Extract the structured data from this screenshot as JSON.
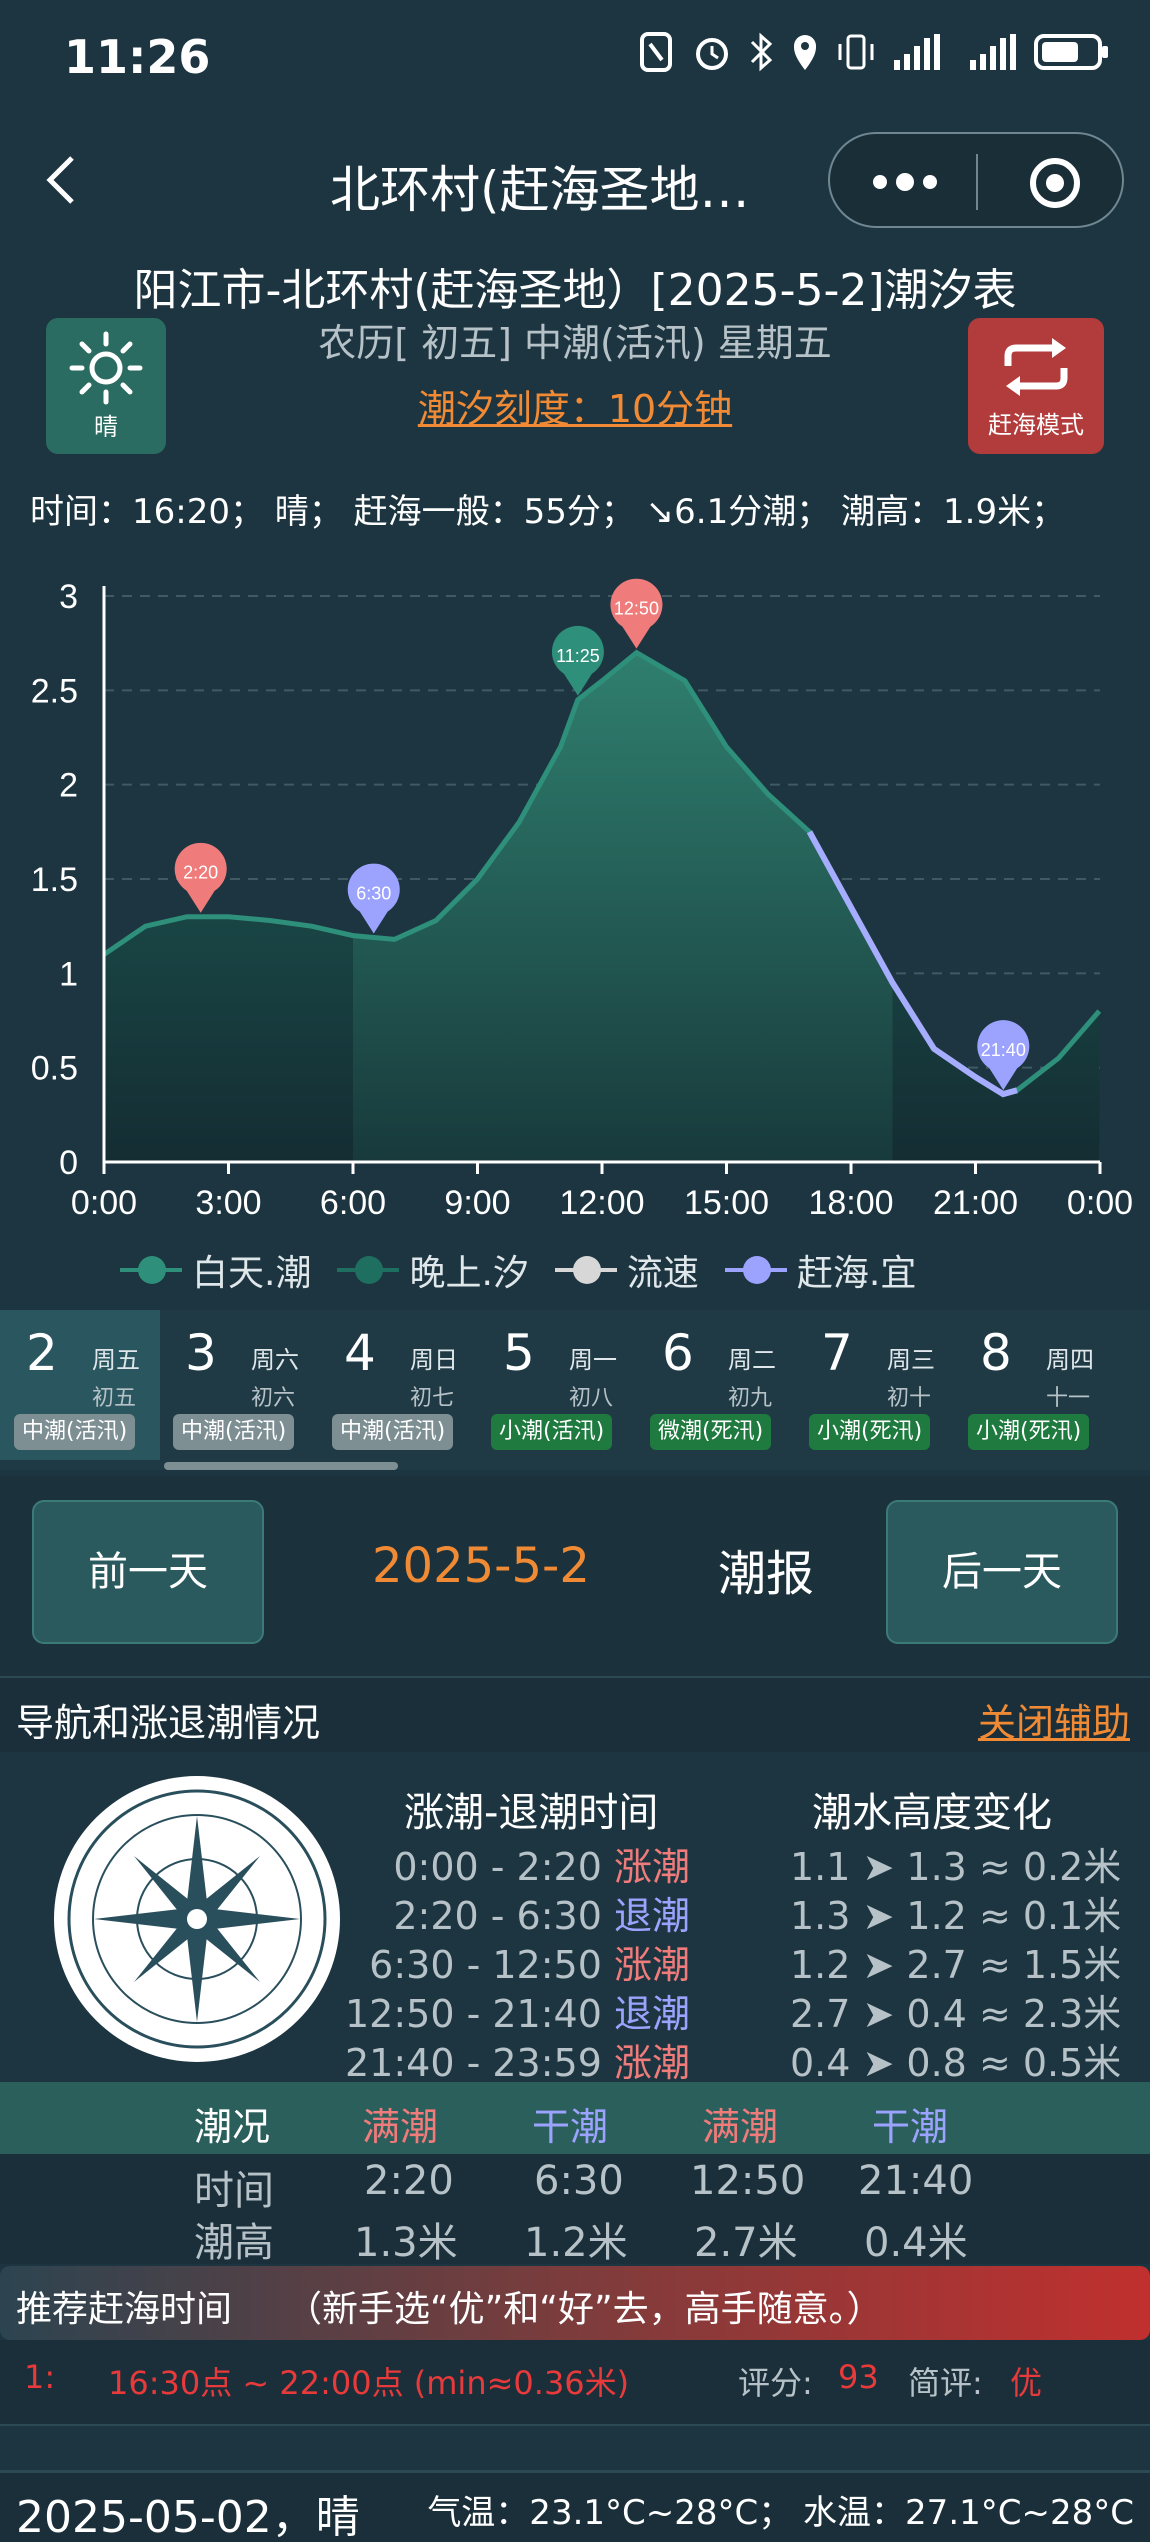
{
  "status": {
    "time": "11:26"
  },
  "header": {
    "title": "北环村(赶海圣地…"
  },
  "info": {
    "heading": "阳江市-北环村(赶海圣地）[2025-5-2]潮汐表",
    "lunar": "农历[ 初五] 中潮(活汛) 星期五",
    "scale": "潮汐刻度：10分钟",
    "weather_label": "晴",
    "mode_label": "赶海模式",
    "line": "时间：16:20； 晴； 赶海一般：55分； ↘6.1分潮； 潮高：1.9米；"
  },
  "chart_data": {
    "type": "area",
    "x": [
      "0:00",
      "1:00",
      "2:00",
      "2:20",
      "3:00",
      "4:00",
      "5:00",
      "6:00",
      "6:30",
      "7:00",
      "8:00",
      "9:00",
      "10:00",
      "11:00",
      "11:25",
      "12:00",
      "12:50",
      "14:00",
      "15:00",
      "16:00",
      "17:00",
      "18:00",
      "19:00",
      "20:00",
      "21:00",
      "21:40",
      "22:00",
      "23:00",
      "23:59"
    ],
    "values": [
      1.1,
      1.25,
      1.3,
      1.3,
      1.3,
      1.28,
      1.25,
      1.2,
      1.19,
      1.18,
      1.28,
      1.5,
      1.8,
      2.2,
      2.45,
      2.55,
      2.7,
      2.55,
      2.2,
      1.95,
      1.75,
      1.35,
      0.95,
      0.6,
      0.45,
      0.36,
      0.38,
      0.55,
      0.8
    ],
    "xticks": [
      "0:00",
      "3:00",
      "6:00",
      "9:00",
      "12:00",
      "15:00",
      "18:00",
      "21:00",
      "0:00"
    ],
    "yticks": [
      "0",
      "0.5",
      "1",
      "1.5",
      "2",
      "2.5",
      "3"
    ],
    "ylim": [
      0,
      3
    ],
    "series_names": [
      "白天.潮",
      "晚上.汐",
      "流速",
      "赶海.宜"
    ],
    "markers": [
      {
        "label": "2:20",
        "x": 2.33,
        "y": 1.3,
        "color": "#ef7b7b"
      },
      {
        "label": "6:30",
        "x": 6.5,
        "y": 1.19,
        "color": "#9ca3ff"
      },
      {
        "label": "11:25",
        "x": 11.42,
        "y": 2.45,
        "color": "#2e8f7a"
      },
      {
        "label": "12:50",
        "x": 12.83,
        "y": 2.7,
        "color": "#ef7b7b"
      },
      {
        "label": "21:40",
        "x": 21.67,
        "y": 0.36,
        "color": "#9ca3ff"
      }
    ],
    "highlight_range": [
      "16:30",
      "22:00"
    ]
  },
  "legend": {
    "day": "白天.潮",
    "night": "晚上.汐",
    "speed": "流速",
    "good": "赶海.宜"
  },
  "days": [
    {
      "num": "2",
      "weekday": "周五",
      "lunar": "初五",
      "tag": "中潮(活汛)",
      "tone": "grey"
    },
    {
      "num": "3",
      "weekday": "周六",
      "lunar": "初六",
      "tag": "中潮(活汛)",
      "tone": "grey"
    },
    {
      "num": "4",
      "weekday": "周日",
      "lunar": "初七",
      "tag": "中潮(活汛)",
      "tone": "grey"
    },
    {
      "num": "5",
      "weekday": "周一",
      "lunar": "初八",
      "tag": "小潮(活汛)",
      "tone": "green"
    },
    {
      "num": "6",
      "weekday": "周二",
      "lunar": "初九",
      "tag": "微潮(死汛)",
      "tone": "green"
    },
    {
      "num": "7",
      "weekday": "周三",
      "lunar": "初十",
      "tag": "小潮(死汛)",
      "tone": "green"
    },
    {
      "num": "8",
      "weekday": "周四",
      "lunar": "十一",
      "tag": "小潮(死汛)",
      "tone": "green"
    }
  ],
  "nav": {
    "prev": "前一天",
    "date": "2025-5-2",
    "report": "潮报",
    "next": "后一天"
  },
  "section": {
    "title": "导航和涨退潮情况",
    "close": "关闭辅助"
  },
  "tide_table": {
    "head_time": "涨潮-退潮时间",
    "head_height": "潮水高度变化",
    "rows": [
      {
        "time": "0:00 - 2:20",
        "type": "涨潮",
        "dir": "up",
        "change": "1.1 ➤ 1.3 ≈ 0.2米"
      },
      {
        "time": "2:20 - 6:30",
        "type": "退潮",
        "dir": "down",
        "change": "1.3 ➤ 1.2 ≈ 0.1米"
      },
      {
        "time": "6:30 - 12:50",
        "type": "涨潮",
        "dir": "up",
        "change": "1.2 ➤ 2.7 ≈ 1.5米"
      },
      {
        "time": "12:50 - 21:40",
        "type": "退潮",
        "dir": "down",
        "change": "2.7 ➤ 0.4 ≈ 2.3米"
      },
      {
        "time": "21:40 - 23:59",
        "type": "涨潮",
        "dir": "up",
        "change": "0.4 ➤ 0.8 ≈ 0.5米"
      }
    ]
  },
  "status_table": {
    "label": "潮况",
    "types": [
      "满潮",
      "干潮",
      "满潮",
      "干潮"
    ],
    "time_label": "时间",
    "times": [
      "2:20",
      "6:30",
      "12:50",
      "21:40"
    ],
    "height_label": "潮高",
    "heights": [
      "1.3米",
      "1.2米",
      "2.7米",
      "0.4米"
    ]
  },
  "recommend": {
    "title": "推荐赶海时间",
    "subtitle": "（新手选“优”和“好”去，高手随意。）",
    "idx": "1:",
    "range": "16:30点 ~ 22:00点 (min≈0.36米)",
    "score_label": "评分:",
    "score": "93",
    "review_label": "简评:",
    "review": "优"
  },
  "footer": {
    "date": "2025-05-02，晴",
    "weather": "气温：23.1°C~28°C；  水温：27.1°C~28°C"
  }
}
